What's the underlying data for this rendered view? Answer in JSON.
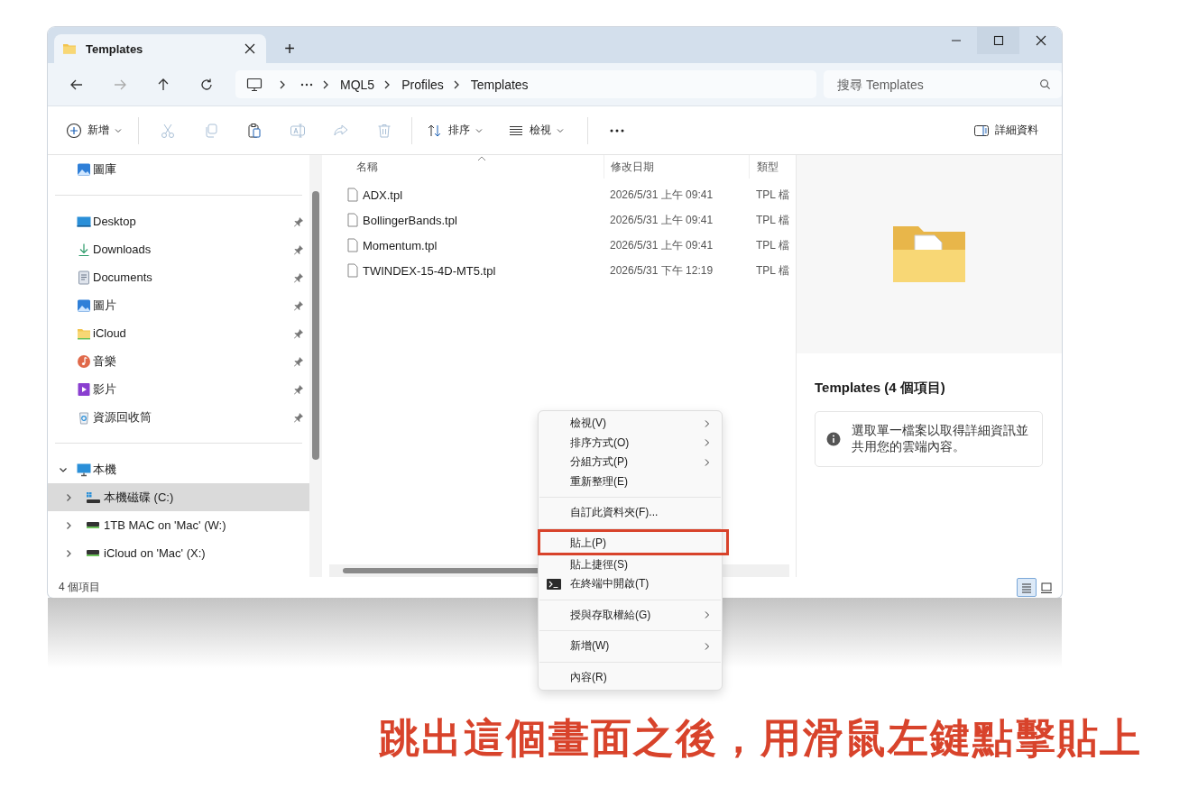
{
  "tab": {
    "title": "Templates",
    "selected": true
  },
  "new_tab_label": "+",
  "address_bar": {
    "path": [
      "MQL5",
      "Profiles",
      "Templates"
    ]
  },
  "search": {
    "placeholder": "搜尋 Templates"
  },
  "toolbar": {
    "new_button": {
      "label": "新增"
    },
    "actions": [
      {
        "kind": "cut",
        "disabled": true
      },
      {
        "kind": "copy",
        "disabled": true
      },
      {
        "kind": "paste",
        "disabled": false
      },
      {
        "kind": "rename",
        "disabled": true
      },
      {
        "kind": "share",
        "disabled": true
      },
      {
        "kind": "delete",
        "disabled": true
      }
    ],
    "sort_button": {
      "label": "排序"
    },
    "view_button": {
      "label": "檢視"
    },
    "details_button": {
      "label": "詳細資料"
    }
  },
  "sidebar": {
    "groups": [
      {
        "items": [
          {
            "label": "圖庫",
            "kind": "gallery",
            "selected": false
          }
        ]
      },
      {
        "items": [
          {
            "label": "Desktop",
            "kind": "desktop",
            "pinned": true,
            "selected": false
          },
          {
            "label": "Downloads",
            "kind": "downloads",
            "pinned": true,
            "selected": false
          },
          {
            "label": "Documents",
            "kind": "documents",
            "pinned": true,
            "selected": false
          },
          {
            "label": "圖片",
            "kind": "pictures",
            "pinned": true,
            "selected": false
          },
          {
            "label": "iCloud",
            "kind": "folder",
            "pinned": true,
            "selected": false
          },
          {
            "label": "音樂",
            "kind": "music",
            "pinned": true,
            "selected": false
          },
          {
            "label": "影片",
            "kind": "videos",
            "pinned": true,
            "selected": false
          },
          {
            "label": "資源回收筒",
            "kind": "recycle",
            "pinned": true,
            "selected": false
          }
        ]
      },
      {
        "items": [
          {
            "label": "本機",
            "kind": "pc",
            "selected": false,
            "expanded": true,
            "children": [
              {
                "label": "本機磁碟 (C:)",
                "kind": "system-drive",
                "selected": true,
                "expanded": false
              },
              {
                "label": "1TB MAC on 'Mac' (W:)",
                "kind": "network-drive",
                "selected": false,
                "expanded": false
              },
              {
                "label": "iCloud on 'Mac' (X:)",
                "kind": "network-drive",
                "selected": false,
                "expanded": false
              }
            ]
          }
        ]
      }
    ]
  },
  "file_list": {
    "columns": [
      {
        "label": "名稱",
        "sorted": true
      },
      {
        "label": "修改日期",
        "sorted": false
      },
      {
        "label": "類型",
        "sorted": false
      }
    ],
    "rows": [
      {
        "name": "ADX.tpl",
        "modified": "2026/5/31 上午 09:41",
        "type": "TPL 檔",
        "selected": false
      },
      {
        "name": "BollingerBands.tpl",
        "modified": "2026/5/31 上午 09:41",
        "type": "TPL 檔",
        "selected": false
      },
      {
        "name": "Momentum.tpl",
        "modified": "2026/5/31 上午 09:41",
        "type": "TPL 檔",
        "selected": false
      },
      {
        "name": "TWINDEX-15-4D-MT5.tpl",
        "modified": "2026/5/31 下午 12:19",
        "type": "TPL 檔",
        "selected": false
      }
    ]
  },
  "details_pane": {
    "title": "Templates (4 個項目)",
    "info": "選取單一檔案以取得詳細資訊並共用您的雲端內容。"
  },
  "status_bar": {
    "count": "4 個項目",
    "view_modes": [
      {
        "kind": "details",
        "selected": true
      },
      {
        "kind": "tiles",
        "selected": false
      }
    ]
  },
  "context_menu": {
    "groups": [
      {
        "items": [
          {
            "label": "檢視(V)",
            "kind": "plain",
            "submenu": true,
            "highlighted": false
          },
          {
            "label": "排序方式(O)",
            "kind": "plain",
            "submenu": true,
            "highlighted": false
          },
          {
            "label": "分組方式(P)",
            "kind": "plain",
            "submenu": true,
            "highlighted": false
          },
          {
            "label": "重新整理(E)",
            "kind": "plain",
            "submenu": false,
            "highlighted": false
          }
        ]
      },
      {
        "items": [
          {
            "label": "自訂此資料夾(F)...",
            "kind": "plain",
            "submenu": false,
            "highlighted": false
          }
        ]
      },
      {
        "items": [
          {
            "label": "貼上(P)",
            "kind": "plain",
            "submenu": false,
            "highlighted": true
          },
          {
            "label": "貼上捷徑(S)",
            "kind": "plain",
            "submenu": false,
            "highlighted": false
          },
          {
            "label": "在終端中開啟(T)",
            "kind": "terminal",
            "submenu": false,
            "highlighted": false
          }
        ]
      },
      {
        "items": [
          {
            "label": "授與存取權給(G)",
            "kind": "plain",
            "submenu": true,
            "highlighted": false
          }
        ]
      },
      {
        "items": [
          {
            "label": "新增(W)",
            "kind": "plain",
            "submenu": true,
            "highlighted": false
          }
        ]
      },
      {
        "items": [
          {
            "label": "內容(R)",
            "kind": "plain",
            "submenu": false,
            "highlighted": false
          }
        ]
      }
    ]
  },
  "caption": "跳出這個畫面之後，用滑鼠左鍵點擊貼上"
}
